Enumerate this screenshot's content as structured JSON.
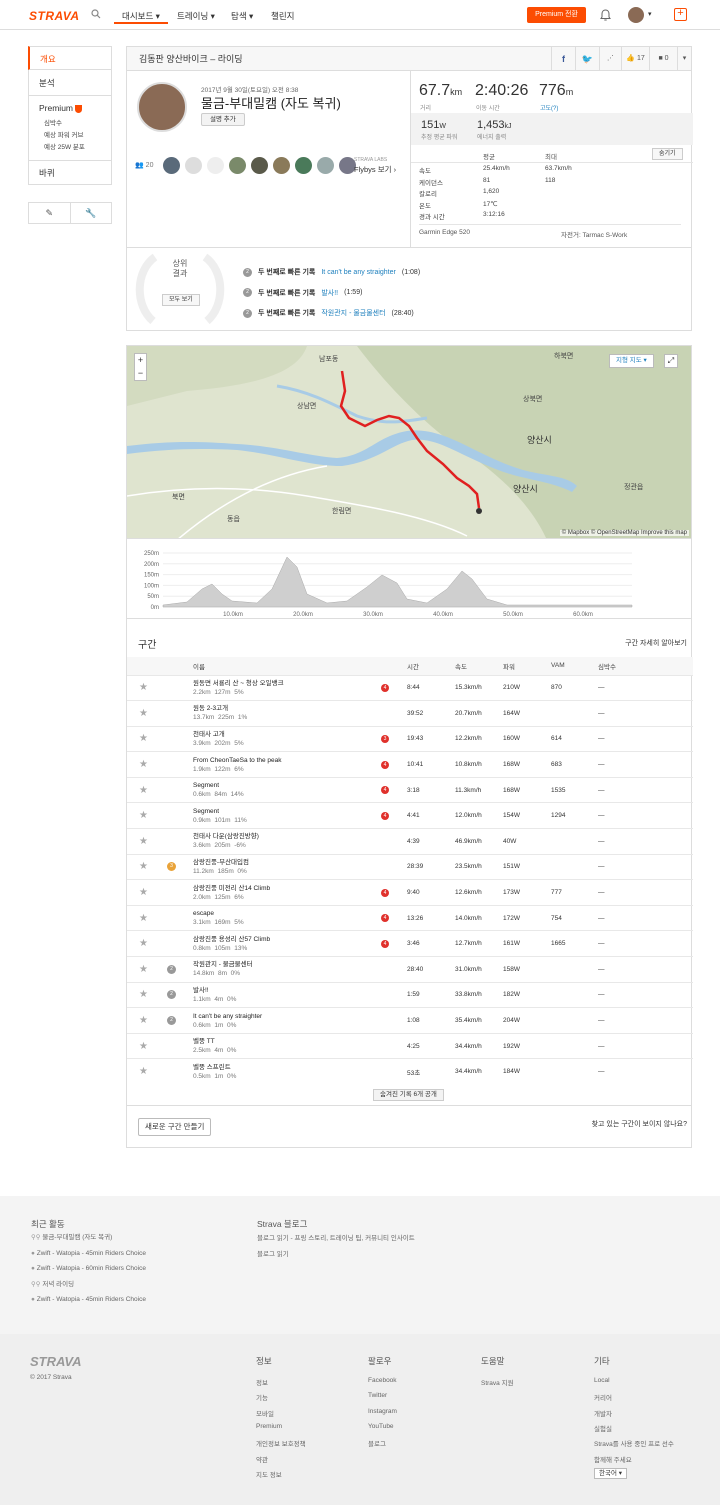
{
  "nav": {
    "logo": "STRAVA",
    "items": [
      "대시보드",
      "트레이닝",
      "탐색",
      "챌린지"
    ],
    "premium_button": "Premium 전환"
  },
  "sidebar": {
    "overview": "개요",
    "analysis": "분석",
    "premium": "Premium",
    "premium_items": [
      "심박수",
      "예상 파워 커브",
      "예상 25W 분포"
    ],
    "gear": "바퀴"
  },
  "activity": {
    "title": "김동판 양산바이크 – 라이딩",
    "like_count": "17",
    "comment_count": "0",
    "date": "2017년 9월 30일(토요일) 오전 8:38",
    "name": "물금-부대밀캠 (자도 복귀)",
    "add_desc": "설명 추가",
    "athletes_count": "20",
    "flybys_lbl": "STRAVA LABS",
    "flybys": "Flybys 보기",
    "distance": "67.7",
    "distance_unit": "km",
    "distance_lbl": "거리",
    "moving_time": "2:40:26",
    "moving_time_lbl": "이동 시간",
    "elevation": "776",
    "elevation_unit": "m",
    "elevation_lbl": "고도(?)",
    "power": "151",
    "power_unit": "W",
    "power_lbl": "추정 평균 파워",
    "energy": "1,453",
    "energy_unit": "kJ",
    "energy_lbl": "에너지 출력",
    "hide_btn": "숨기기",
    "col_avg": "평균",
    "col_max": "최대",
    "rows": [
      {
        "label": "속도",
        "avg": "25.4km/h",
        "max": "63.7km/h"
      },
      {
        "label": "케이던스",
        "avg": "81",
        "max": "118"
      },
      {
        "label": "칼로리",
        "avg": "1,620",
        "max": ""
      },
      {
        "label": "온도",
        "avg": "17℃",
        "max": ""
      },
      {
        "label": "경과 시간",
        "avg": "3:12:16",
        "max": ""
      }
    ],
    "device": "Garmin Edge 520",
    "bike": "자전거: Tarmac S-Work"
  },
  "achievements": {
    "laurel_title": "상위\n결과",
    "show_all": "모두 보기",
    "items": [
      {
        "prefix": "두 번째로 빠른 기록",
        "name": "It can't be any straighter",
        "time": "(1:08)"
      },
      {
        "prefix": "두 번째로 빠른 기록",
        "name": "발사!!",
        "time": "(1:59)"
      },
      {
        "prefix": "두 번째로 빠른 기록",
        "name": "작원관지 - 물금물센터",
        "time": "(28:40)"
      }
    ]
  },
  "map": {
    "type_btn": "지형 지도",
    "attribution": "© Mapbox © OpenStreetMap Improve this map",
    "labels": [
      "남포동",
      "하북면",
      "상북면",
      "양산시",
      "양산시",
      "상남면",
      "동읍",
      "한림면",
      "북면",
      "정관읍"
    ]
  },
  "elevation_chart": {
    "y_ticks": [
      "250m",
      "200m",
      "150m",
      "100m",
      "50m",
      "0m"
    ],
    "x_ticks": [
      "10.0km",
      "20.0km",
      "30.0km",
      "40.0km",
      "50.0km",
      "60.0km"
    ]
  },
  "segments": {
    "title": "구간",
    "learn_more": "구간 자세히 알아보기",
    "headers": [
      "이름",
      "시간",
      "속도",
      "파워",
      "VAM",
      "심박수"
    ],
    "rows": [
      {
        "name": "원동면 서룡리 산 ~ 청상 오일뱅크",
        "dist": "2.2km",
        "elev": "127m",
        "grade": "5%",
        "kom": "4",
        "medal": "",
        "time": "8:44",
        "speed": "15.3km/h",
        "power": "210W",
        "vam": "870",
        "hr": "—"
      },
      {
        "name": "원동 2-3고개",
        "dist": "13.7km",
        "elev": "225m",
        "grade": "1%",
        "kom": "",
        "medal": "",
        "time": "39:52",
        "speed": "20.7km/h",
        "power": "164W",
        "vam": "",
        "hr": "—"
      },
      {
        "name": "천태사 고개",
        "dist": "3.9km",
        "elev": "202m",
        "grade": "5%",
        "kom": "3",
        "medal": "",
        "time": "19:43",
        "speed": "12.2km/h",
        "power": "160W",
        "vam": "614",
        "hr": "—"
      },
      {
        "name": "From CheonTaeSa to the peak",
        "dist": "1.9km",
        "elev": "122m",
        "grade": "6%",
        "kom": "4",
        "medal": "",
        "time": "10:41",
        "speed": "10.8km/h",
        "power": "168W",
        "vam": "683",
        "hr": "—"
      },
      {
        "name": "Segment",
        "dist": "0.6km",
        "elev": "84m",
        "grade": "14%",
        "kom": "4",
        "medal": "",
        "time": "3:18",
        "speed": "11.3km/h",
        "power": "168W",
        "vam": "1535",
        "hr": "—"
      },
      {
        "name": "Segment",
        "dist": "0.9km",
        "elev": "101m",
        "grade": "11%",
        "kom": "4",
        "medal": "",
        "time": "4:41",
        "speed": "12.0km/h",
        "power": "154W",
        "vam": "1294",
        "hr": "—"
      },
      {
        "name": "천태사 다운(삼랑진방향)",
        "dist": "3.6km",
        "elev": "205m",
        "grade": "-6%",
        "kom": "",
        "medal": "",
        "time": "4:39",
        "speed": "46.9km/h",
        "power": "40W",
        "vam": "",
        "hr": "—"
      },
      {
        "name": "삼랑진풍-부산대입컴",
        "dist": "11.2km",
        "elev": "185m",
        "grade": "0%",
        "kom": "",
        "medal": "3",
        "time": "28:39",
        "speed": "23.5km/h",
        "power": "151W",
        "vam": "",
        "hr": "—"
      },
      {
        "name": "삼랑진풍 미전리 산14 Climb",
        "dist": "2.0km",
        "elev": "125m",
        "grade": "6%",
        "kom": "4",
        "medal": "",
        "time": "9:40",
        "speed": "12.6km/h",
        "power": "173W",
        "vam": "777",
        "hr": "—"
      },
      {
        "name": "escape",
        "dist": "3.1km",
        "elev": "169m",
        "grade": "5%",
        "kom": "4",
        "medal": "",
        "time": "13:26",
        "speed": "14.0km/h",
        "power": "172W",
        "vam": "754",
        "hr": "—"
      },
      {
        "name": "삼랑진풍 용성리 산57 Climb",
        "dist": "0.8km",
        "elev": "105m",
        "grade": "13%",
        "kom": "4",
        "medal": "",
        "time": "3:46",
        "speed": "12.7km/h",
        "power": "161W",
        "vam": "1665",
        "hr": "—"
      },
      {
        "name": "작원관지 - 물금물센터",
        "dist": "14.8km",
        "elev": "8m",
        "grade": "0%",
        "kom": "",
        "medal": "2",
        "time": "28:40",
        "speed": "31.0km/h",
        "power": "158W",
        "vam": "",
        "hr": "—"
      },
      {
        "name": "발사!!",
        "dist": "1.1km",
        "elev": "4m",
        "grade": "0%",
        "kom": "",
        "medal": "2",
        "time": "1:59",
        "speed": "33.8km/h",
        "power": "182W",
        "vam": "",
        "hr": "—"
      },
      {
        "name": "It can't be any straighter",
        "dist": "0.6km",
        "elev": "1m",
        "grade": "0%",
        "kom": "",
        "medal": "2",
        "time": "1:08",
        "speed": "35.4km/h",
        "power": "204W",
        "vam": "",
        "hr": "—"
      },
      {
        "name": "벨뚱 TT",
        "dist": "2.5km",
        "elev": "4m",
        "grade": "0%",
        "kom": "",
        "medal": "",
        "time": "4:25",
        "speed": "34.4km/h",
        "power": "192W",
        "vam": "",
        "hr": "—"
      },
      {
        "name": "벨뚱 스프린트",
        "dist": "0.5km",
        "elev": "1m",
        "grade": "0%",
        "kom": "",
        "medal": "",
        "time": "53초",
        "speed": "34.4km/h",
        "power": "184W",
        "vam": "",
        "hr": "—"
      }
    ],
    "hidden_btn": "숨겨진 기록 6개 공개",
    "create_btn": "새로운 구간 만들기",
    "not_found": "찾고 있는 구간이 보이지 않나요?"
  },
  "recent": {
    "title": "최근 활동",
    "items": [
      "물금-부대밀캠 (자도 복귀)",
      "Zwift - Watopia - 45min Riders Choice",
      "Zwift - Watopia - 60min Riders Choice",
      "저녁 라이딩",
      "Zwift - Watopia - 45min Riders Choice"
    ]
  },
  "blog": {
    "title": "Strava 블로그",
    "desc": "블로그 읽기 - 프링 스토리, 트레이닝 팁, 커뮤니티 인사이트",
    "read": "블로그 읽기"
  },
  "footer": {
    "logo": "STRAVA",
    "copyright": "© 2017 Strava",
    "cols": [
      {
        "title": "정보",
        "items": [
          "정보",
          "기능",
          "모바일",
          "Premium",
          "개인정보 보호정책",
          "약관",
          "지도 정보"
        ]
      },
      {
        "title": "팔로우",
        "items": [
          "Facebook",
          "Twitter",
          "Instagram",
          "YouTube",
          "블로그"
        ]
      },
      {
        "title": "도움말",
        "items": [
          "Strava 지원"
        ]
      },
      {
        "title": "기타",
        "items": [
          "Local",
          "커리어",
          "개발자",
          "실험실",
          "Strava를 사용 중인 프로 선수",
          "함께해 주세요"
        ]
      }
    ],
    "language": "한국어"
  }
}
